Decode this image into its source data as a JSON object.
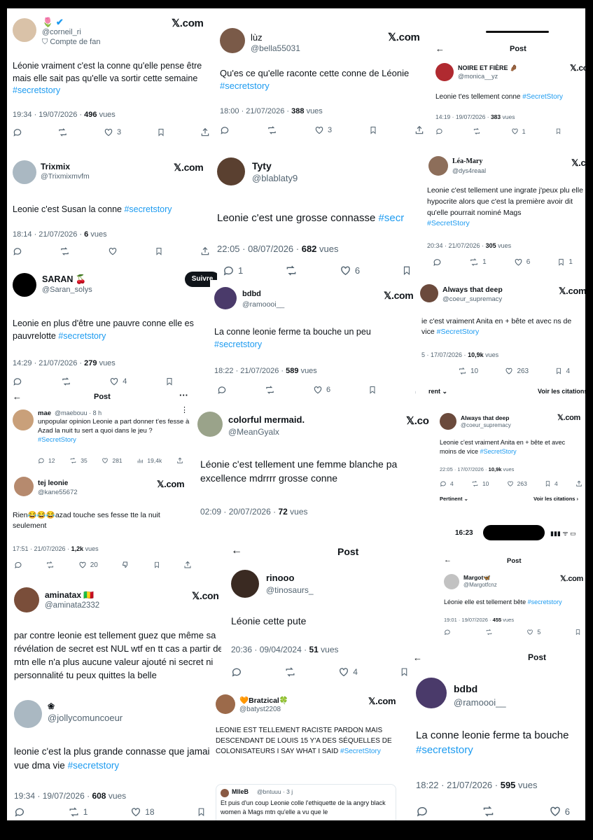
{
  "x_label": "𝕏.com",
  "post_title": "Post",
  "cards": {
    "c1": {
      "handle": "@corneil_ri",
      "badge": "Compte de fan",
      "text": "Léonie vraiment c'est la conne qu'elle pense être mais elle sait pas qu'elle va sortir cette semaine",
      "tag": "#secretstory",
      "time": "19:34 · 19/07/2026 ·",
      "views": "496",
      "views_label": "vues",
      "likes": "3"
    },
    "c2": {
      "name": "lùz",
      "handle": "@bella55031",
      "text": "Qu'es ce qu'elle raconte cette conne de Léonie",
      "tag": "#secretstory",
      "time": "18:00 · 21/07/2026 ·",
      "views": "388",
      "views_label": "vues",
      "likes": "3"
    },
    "c3": {
      "name": "NOIRE ET FIÈRE 🤌🏾",
      "handle": "@monica__yz",
      "text": "Leonie t'es tellement conne",
      "tag": "#SecretStory",
      "time": "14:19 · 19/07/2026 ·",
      "views": "383",
      "views_label": "vues",
      "likes": "1"
    },
    "c4": {
      "name": "Trixmix",
      "handle": "@Trixmixmvfm",
      "text": "Leonie c'est Susan la conne",
      "tag": "#secretstory",
      "time": "18:14 · 21/07/2026 ·",
      "views": "6",
      "views_label": "vues"
    },
    "c5": {
      "name": "Tyty",
      "handle": "@blablaty9",
      "text": "Leonie c'est une grosse connasse",
      "tag": "#secr",
      "time": "22:05 · 08/07/2026 ·",
      "views": "682",
      "views_label": "vues",
      "retweets": "1",
      "likes": "6"
    },
    "c6": {
      "name": "Léa-Mary",
      "handle": "@dys4reaal",
      "text": "Leonie c'est tellement une ingrate j'peux plu elle est hypocrite alors que c'est la première avoir dit qu'elle pourrait nominé Mags",
      "tag": "#SecretStory",
      "time": "20:34 · 21/07/2026 ·",
      "views": "305",
      "views_label": "vues",
      "retweets": "1",
      "likes": "6",
      "bookmarks": "1"
    },
    "c7": {
      "name": "SARAN 🍒",
      "handle": "@Saran_solys",
      "follow": "Suivre",
      "text": "Leonie en plus d'être une pauvre conne elle es pauvrelotte",
      "tag": "#secretstory",
      "time": "14:29 · 21/07/2026 ·",
      "views": "279",
      "views_label": "vues",
      "likes": "4"
    },
    "c8": {
      "name": "bdbd",
      "handle": "@ramoooi__",
      "text": "La conne leonie ferme ta bouche un peu",
      "tag": "#secretstory",
      "time": "18:22 · 21/07/2026 ·",
      "views": "589",
      "views_label": "vues",
      "likes": "6"
    },
    "c9": {
      "name": "Always that deep",
      "handle": "@coeur_supremacy",
      "text": "ie c'est vraiment Anita en + bête et avec ns de vice",
      "tag": "#SecretStory",
      "time": "5 · 17/07/2026 ·",
      "views": "10,9k",
      "views_label": "vues",
      "retweets": "10",
      "likes": "263",
      "bookmarks": "4",
      "footer_left": "rent ⌄",
      "footer_right": "Voir les citations"
    },
    "c10": {
      "name": "mae",
      "handle": "@maebouu · 8 h",
      "text": "unpopular opinion Leonie a part donner t'es fesse à Azad la nuit tu sert a quoi dans le jeu ?",
      "tag": "#SecretStory",
      "replies": "12",
      "retweets": "35",
      "likes": "281",
      "views": "19,4k"
    },
    "c11": {
      "name": "tej leonie",
      "handle": "@kane55672",
      "text": "Rien😂😂😂azad touche ses fesse tte la nuit seulement",
      "time": "17:51 · 21/07/2026 ·",
      "views": "1,2k",
      "views_label": "vues",
      "likes": "20"
    },
    "c12": {
      "name": "colorful mermaid.",
      "handle": "@MeanGyalx",
      "x_partial": "𝕏.co",
      "text": "Léonie c'est tellement une femme blanche pa excellence mdrrrr grosse conne",
      "time": "02:09 · 20/07/2026 ·",
      "views": "72",
      "views_label": "vues"
    },
    "c13": {
      "name": "Always that deep",
      "handle": "@coeur_supremacy",
      "text": "Leonie c'est vraiment Anita en + bête et avec moins de vice",
      "tag": "#SecretStory",
      "time": "22:05 · 17/07/2026 ·",
      "views": "10,9k",
      "views_label": "vues",
      "retweets": "10",
      "likes": "263",
      "bookmarks": "4",
      "footer_left": "Pertinent ⌄",
      "footer_right": "Voir les citations ›"
    },
    "c14": {
      "name": "rinooo",
      "handle": "@tinosaurs_",
      "text": "Léonie cette pute",
      "time": "20:36 · 09/04/2024 ·",
      "views": "51",
      "views_label": "vues",
      "likes": "4"
    },
    "c15": {
      "status_time": "16:23",
      "name": "Margot🦋",
      "handle": "@Margotfcnz",
      "text": "Léonie elle est tellement bête",
      "tag": "#secretstory",
      "time": "19:01 · 19/07/2026 ·",
      "views": "455",
      "views_label": "vues",
      "likes": "5"
    },
    "c16": {
      "name": "aminatax 🇲🇱",
      "handle": "@aminata2332",
      "x_partial": "𝕏.con",
      "text": "par contre leonie est tellement guez que même sa révélation de secret est NUL wtf en tt cas a partir de mtn elle n'a plus aucune valeur ajouté ni secret ni personnalité tu peux quittes la belle"
    },
    "c17": {
      "name": "❀",
      "handle": "@jollycomuncoeur",
      "text": "leonie c'est la plus grande connasse que jamais vue dma vie",
      "tag": "#secretstory",
      "time": "19:34 · 19/07/2026 ·",
      "views": "608",
      "views_label": "vues",
      "retweets": "1",
      "likes": "18",
      "bookmarks": "1"
    },
    "c18": {
      "name": "🧡Bratzical🍀",
      "handle": "@batyst2208",
      "text": "LEONIE EST TELLEMENT RACISTE PARDON MAIS DESCENDANT DE LOUIS 15 Y'A DES SÉQUELLES DE COLONISATEURS I SAY WHAT I SAID",
      "tag": "#SecretStory",
      "quote_name": "MlleB",
      "quote_handle": "@bntuuu · 3 j",
      "quote_text": "Et puis d'un coup Leonie colle l'ethiquette de la angry black women à Mags mtn qu'elle a vu que le"
    },
    "c19": {
      "title_partial": "Post",
      "name": "bdbd",
      "handle": "@ramoooi__",
      "text": "La conne leonie ferme ta bouche",
      "tag": "#secretstory",
      "time": "18:22 · 21/07/2026 ·",
      "views": "595",
      "views_label": "vues",
      "likes": "6"
    }
  },
  "colors": {
    "accent": "#1d9bf0",
    "text": "#0f1419",
    "muted": "#536471",
    "verified": "#1d9bf0"
  }
}
